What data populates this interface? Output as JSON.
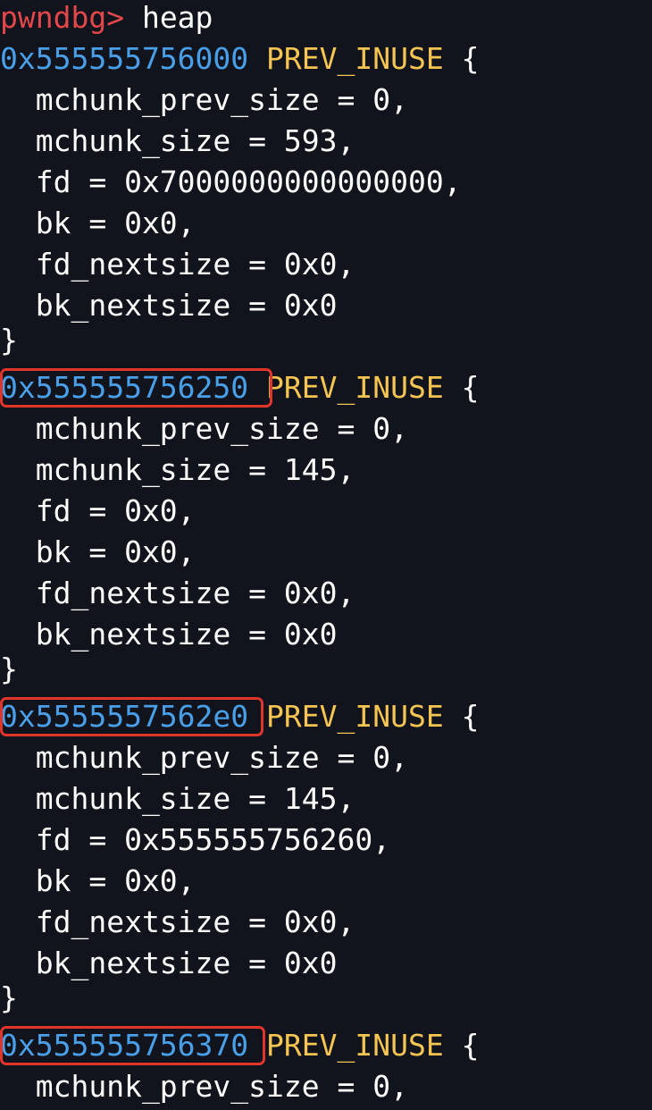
{
  "prompt": {
    "label": "pwndbg>",
    "command": " heap"
  },
  "chunks": [
    {
      "address": "0x555555756000",
      "flag": " PREV_INUSE",
      "open": " {",
      "fields": [
        "  mchunk_prev_size = 0,",
        "  mchunk_size = 593,",
        "  fd = 0x7000000000000000,",
        "  bk = 0x0,",
        "  fd_nextsize = 0x0,",
        "  bk_nextsize = 0x0"
      ],
      "close": "}"
    },
    {
      "address": "0x555555756250",
      "flag": " PREV_INUSE",
      "open": " {",
      "fields": [
        "  mchunk_prev_size = 0,",
        "  mchunk_size = 145,",
        "  fd = 0x0,",
        "  bk = 0x0,",
        "  fd_nextsize = 0x0,",
        "  bk_nextsize = 0x0"
      ],
      "close": "}"
    },
    {
      "address": "0x5555557562e0",
      "flag": " PREV_INUSE",
      "open": " {",
      "fields": [
        "  mchunk_prev_size = 0,",
        "  mchunk_size = 145,",
        "  fd = 0x555555756260,",
        "  bk = 0x0,",
        "  fd_nextsize = 0x0,",
        "  bk_nextsize = 0x0"
      ],
      "close": "}"
    },
    {
      "address": "0x555555756370",
      "flag": " PREV_INUSE",
      "open": " {",
      "fields": [
        "  mchunk_prev_size = 0,"
      ],
      "close": ""
    }
  ],
  "colors": {
    "background": "#11131d",
    "prompt": "#e2474a",
    "address": "#4aa0e8",
    "flag": "#f5c451",
    "text": "#ffffff",
    "highlight_box": "#e0352b"
  }
}
